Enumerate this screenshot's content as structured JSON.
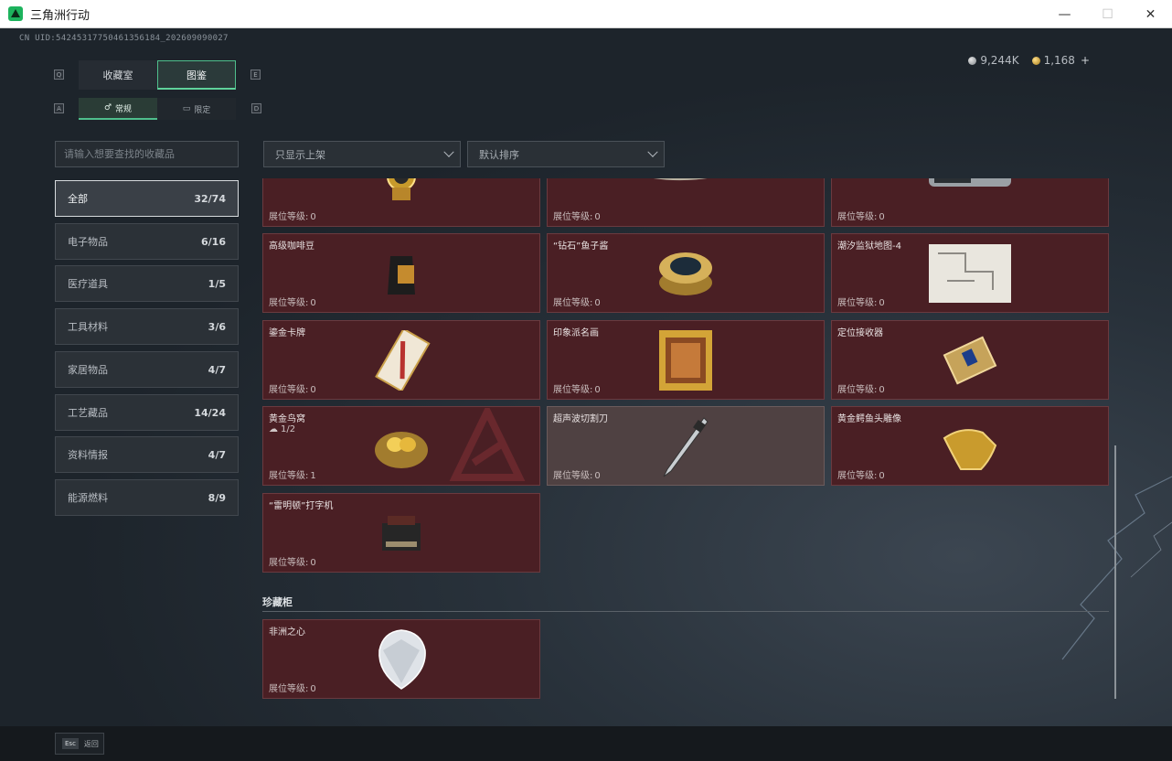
{
  "window": {
    "title": "三角洲行动",
    "minimize": "—",
    "maximize": "☐",
    "close": "✕"
  },
  "header": {
    "uid": "CN UID:54245317750461356184_202609090027",
    "currency": [
      {
        "icon": "silver-coin-icon",
        "value": "9,244K"
      },
      {
        "icon": "gold-coin-icon",
        "value": "1,168"
      }
    ],
    "add_label": "+"
  },
  "tabs": {
    "left_key": "Q",
    "right_key": "E",
    "items": [
      {
        "label": "收藏室",
        "active": false
      },
      {
        "label": "图鉴",
        "active": true
      }
    ]
  },
  "subtabs": {
    "left_key": "A",
    "right_key": "D",
    "items": [
      {
        "label": "常规",
        "active": true
      },
      {
        "label": "限定",
        "active": false
      }
    ]
  },
  "search": {
    "placeholder": "请输入想要查找的收藏品",
    "value": ""
  },
  "filters": {
    "shelf": "只显示上架",
    "sort": "默认排序"
  },
  "categories": [
    {
      "label": "全部",
      "count": "32/74",
      "active": true
    },
    {
      "label": "电子物品",
      "count": "6/16"
    },
    {
      "label": "医疗道具",
      "count": "1/5"
    },
    {
      "label": "工具材料",
      "count": "3/6"
    },
    {
      "label": "家居物品",
      "count": "4/7"
    },
    {
      "label": "工艺藏品",
      "count": "14/24"
    },
    {
      "label": "资料情报",
      "count": "4/7"
    },
    {
      "label": "能源燃料",
      "count": "8/9"
    }
  ],
  "level_label": "展位等级:",
  "items": [
    {
      "name": "",
      "level": "0",
      "icon": "gold-watch-icon"
    },
    {
      "name": "",
      "level": "0",
      "icon": "horn-icon"
    },
    {
      "name": "",
      "level": "0",
      "icon": "server-icon"
    },
    {
      "name": "高级咖啡豆",
      "level": "0",
      "icon": "coffee-bag-icon"
    },
    {
      "name": "“钻石”鱼子酱",
      "level": "0",
      "icon": "caviar-tin-icon"
    },
    {
      "name": "潮汐监狱地图-4",
      "level": "0",
      "icon": "map-icon"
    },
    {
      "name": "鎏金卡牌",
      "level": "0",
      "icon": "card-icon"
    },
    {
      "name": "印象派名画",
      "level": "0",
      "icon": "painting-icon"
    },
    {
      "name": "定位接收器",
      "level": "0",
      "icon": "receiver-icon"
    },
    {
      "name": "黄金鸟窝",
      "level": "1",
      "sub": "1/2",
      "icon": "golden-nest-icon"
    },
    {
      "name": "超声波切割刀",
      "level": "0",
      "icon": "cutter-knife-icon",
      "dim": true
    },
    {
      "name": "黄金鳄鱼头雕像",
      "level": "0",
      "icon": "croc-statue-icon"
    },
    {
      "name": "“雷明顿”打字机",
      "level": "0",
      "icon": "typewriter-icon"
    }
  ],
  "showcase": {
    "title": "珍藏柜",
    "items": [
      {
        "name": "非洲之心",
        "level": "0",
        "icon": "diamond-icon"
      }
    ]
  },
  "footer": {
    "esc_key": "Esc",
    "back_label": "返回"
  },
  "colors": {
    "accent": "#4fbf8c",
    "card_bg": "#4a1f24",
    "card_dim_bg": "#4f4142"
  }
}
